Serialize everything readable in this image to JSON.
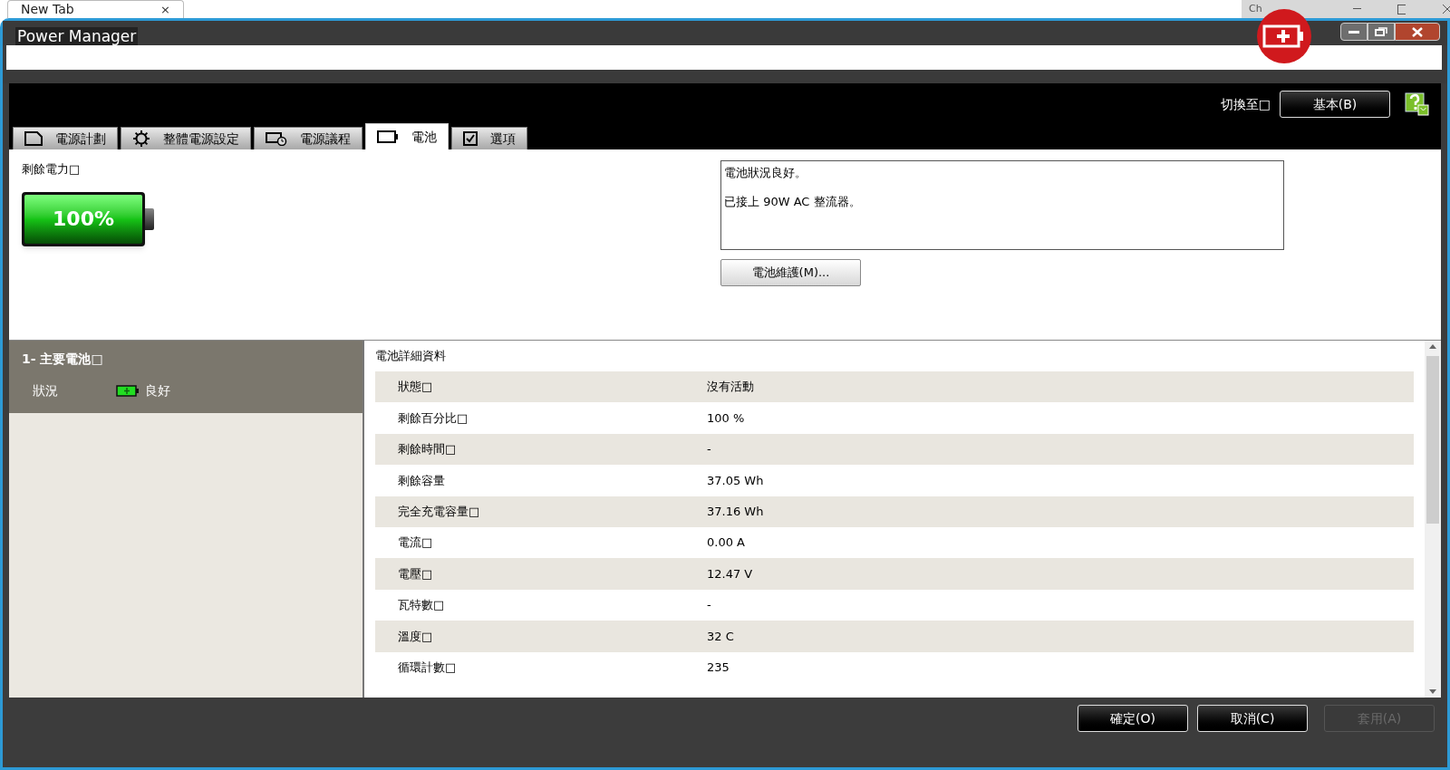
{
  "browser": {
    "tab_title": "New Tab",
    "tab_close": "×",
    "behind_window_title": "Ch"
  },
  "window": {
    "title": "Power Manager"
  },
  "header": {
    "switch_label": "切換至□",
    "switch_button": "基本(B)"
  },
  "tabs": [
    {
      "label": "電源計劃",
      "kind": "plan",
      "selected": false
    },
    {
      "label": "整體電源設定",
      "kind": "gear",
      "selected": false
    },
    {
      "label": "電源議程",
      "kind": "schedule",
      "selected": false
    },
    {
      "label": "電池",
      "kind": "battery",
      "selected": true
    },
    {
      "label": "選項",
      "kind": "check",
      "selected": false
    }
  ],
  "remaining": {
    "label": "剩餘電力□",
    "percent": "100%",
    "level": 1
  },
  "messages": [
    "電池狀況良好。",
    "已接上 90W AC 整流器。"
  ],
  "maintenance_button": "電池維護(M)...",
  "battery_list": [
    {
      "title": "1- 主要電池□",
      "status_label": "狀況",
      "status": "良好",
      "selected": true
    }
  ],
  "details": {
    "title": "電池詳細資料",
    "rows": [
      {
        "label": "狀態□",
        "value": "沒有活動"
      },
      {
        "label": "剩餘百分比□",
        "value": "100 %"
      },
      {
        "label": "剩餘時間□",
        "value": "-"
      },
      {
        "label": "剩餘容量",
        "value": "37.05 Wh"
      },
      {
        "label": "完全充電容量□",
        "value": "37.16 Wh"
      },
      {
        "label": "電流□",
        "value": "0.00 A"
      },
      {
        "label": "電壓□",
        "value": "12.47 V"
      },
      {
        "label": "瓦特數□",
        "value": "-"
      },
      {
        "label": "溫度□",
        "value": "32 C"
      },
      {
        "label": "循環計數□",
        "value": "235"
      }
    ]
  },
  "footer_buttons": [
    {
      "label": "確定(O)",
      "disabled": false
    },
    {
      "label": "取消(C)",
      "disabled": false
    },
    {
      "label": "套用(A)",
      "disabled": true
    }
  ]
}
